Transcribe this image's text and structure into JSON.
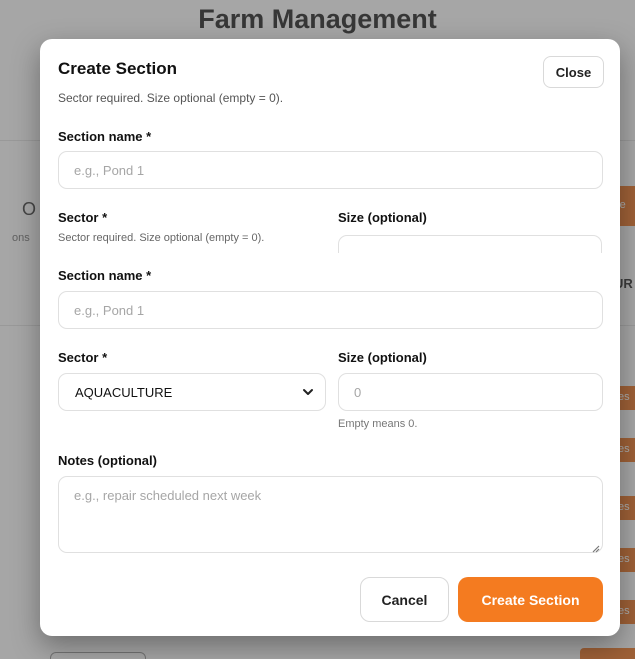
{
  "background": {
    "page_title": "Farm Management",
    "side_letter": "O",
    "side_text": "ons",
    "right_button_text": "re",
    "right_header_text": "UR",
    "row_button_text": "es"
  },
  "modal": {
    "title": "Create Section",
    "subtitle": "Sector required. Size optional (empty = 0).",
    "close_label": "Close",
    "ghost": {
      "section_name_label": "Section name *",
      "section_name_placeholder": "e.g., Pond 1",
      "sector_label": "Sector *",
      "size_label": "Size (optional)",
      "subtitle": "Sector required. Size optional (empty = 0)."
    },
    "form": {
      "section_name_label": "Section name *",
      "section_name_placeholder": "e.g., Pond 1",
      "sector_label": "Sector *",
      "sector_value": "AQUACULTURE",
      "size_label": "Size (optional)",
      "size_placeholder": "0",
      "size_hint": "Empty means 0.",
      "notes_label": "Notes (optional)",
      "notes_placeholder": "e.g., repair scheduled next week"
    },
    "actions": {
      "cancel_label": "Cancel",
      "submit_label": "Create Section"
    }
  },
  "colors": {
    "accent": "#f47b20",
    "overlay": "rgba(70,70,70,0.45)"
  },
  "icons": [
    "chevron-down-icon",
    "resize-grip-icon"
  ]
}
